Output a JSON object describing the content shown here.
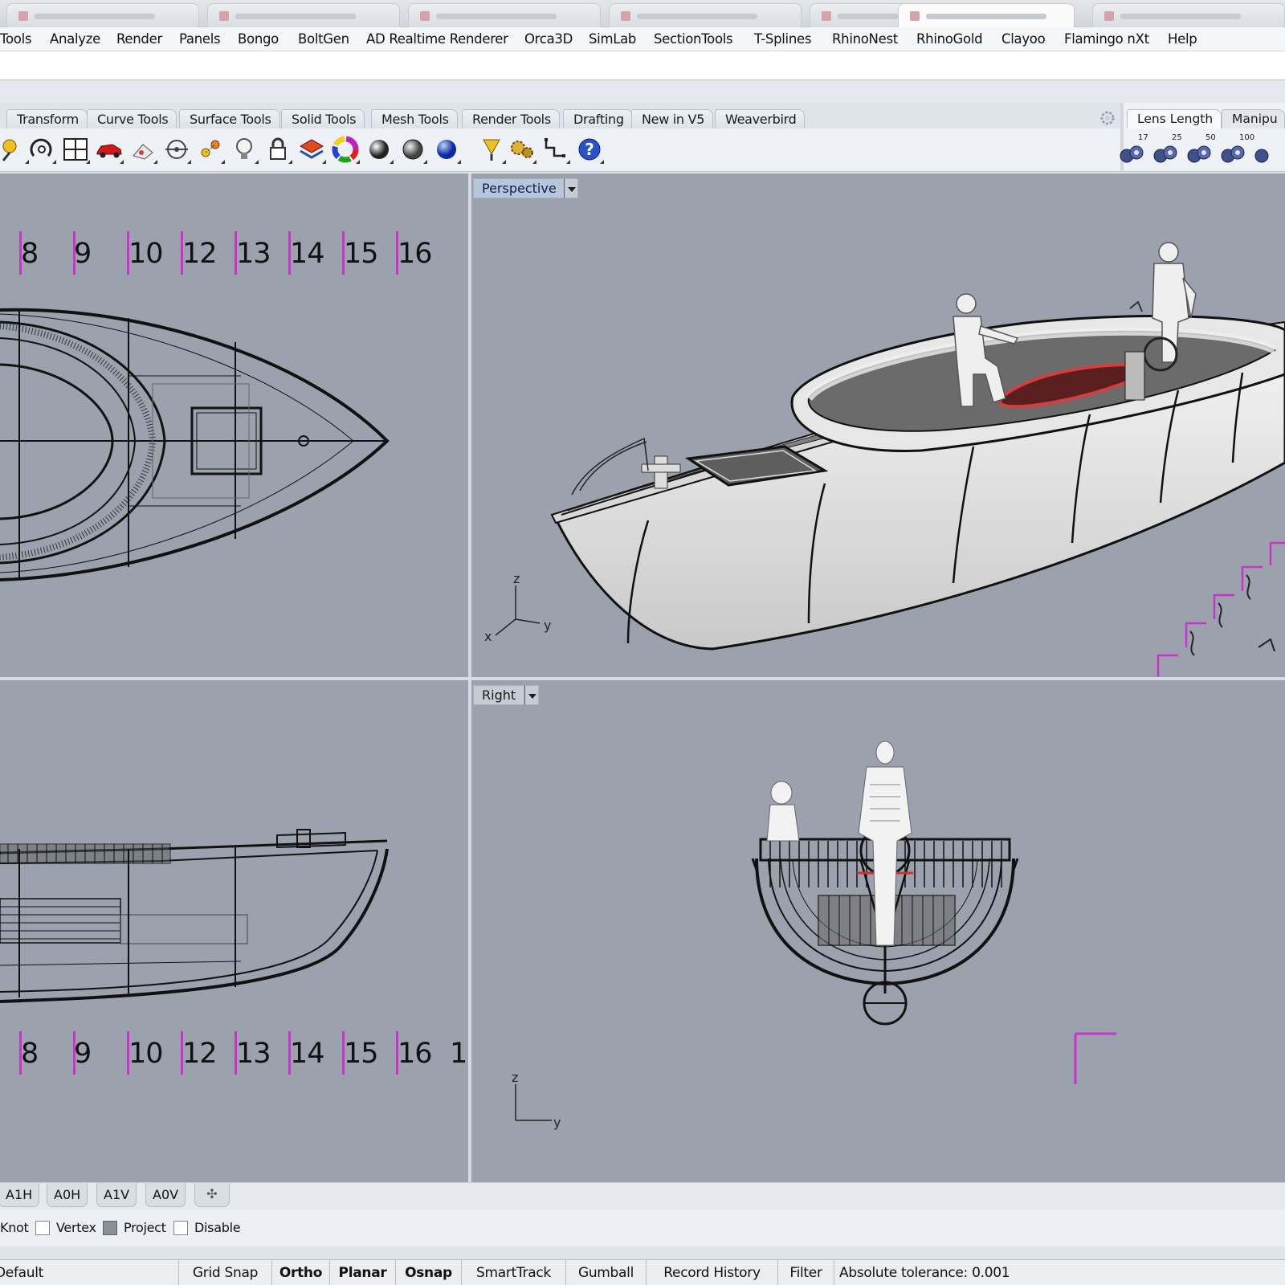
{
  "menu": {
    "items": [
      "Tools",
      "Analyze",
      "Render",
      "Panels",
      "Bongo",
      "BoltGen",
      "AD Realtime Renderer",
      "Orca3D",
      "SimLab",
      "SectionTools",
      "T-Splines",
      "RhinoNest",
      "RhinoGold",
      "Clayoo",
      "Flamingo nXt",
      "Help"
    ]
  },
  "command": {
    "value": ""
  },
  "toolbar": {
    "tabs": [
      "Transform",
      "Curve Tools",
      "Surface Tools",
      "Solid Tools",
      "Mesh Tools",
      "Render Tools",
      "Drafting",
      "New in V5",
      "Weaverbird"
    ],
    "icons": [
      "pen-icon",
      "rotate-view-icon",
      "four-viewports-icon",
      "car-icon",
      "dimension-icon",
      "target-icon",
      "snap-icon",
      "light-bulb-icon",
      "lock-icon",
      "layer-icon",
      "color-wheel-icon",
      "sphere-icon",
      "shaded-sphere-icon",
      "render-sphere-icon",
      "select-filter-icon",
      "gears-icon",
      "steps-icon",
      "help-icon"
    ]
  },
  "right_panel": {
    "tabs": [
      "Lens Length",
      "Manipu"
    ],
    "lens_values": [
      "17",
      "25",
      "50",
      "100"
    ]
  },
  "viewports": {
    "top": {
      "ruler": [
        "8",
        "9",
        "10",
        "12",
        "13",
        "14",
        "15",
        "16"
      ]
    },
    "perspective": {
      "label": "Perspective",
      "axes": {
        "z": "z",
        "x": "x",
        "y": "y"
      }
    },
    "front": {
      "ruler": [
        "8",
        "9",
        "10",
        "12",
        "13",
        "14",
        "15",
        "16",
        "1"
      ]
    },
    "right": {
      "label": "Right",
      "axes": {
        "z": "z",
        "y": "y"
      }
    }
  },
  "layout_tabs": [
    "A1H",
    "A0H",
    "A1V",
    "A0V"
  ],
  "osnap": {
    "items": [
      {
        "label": "Knot",
        "checked": null
      },
      {
        "label": "Vertex",
        "checked": false
      },
      {
        "label": "Project",
        "checked": true
      },
      {
        "label": "Disable",
        "checked": false
      }
    ]
  },
  "status": {
    "layer": "Default",
    "toggles": [
      {
        "label": "Grid Snap",
        "active": false
      },
      {
        "label": "Ortho",
        "active": true
      },
      {
        "label": "Planar",
        "active": true
      },
      {
        "label": "Osnap",
        "active": true
      },
      {
        "label": "SmartTrack",
        "active": false
      },
      {
        "label": "Gumball",
        "active": false
      },
      {
        "label": "Record History",
        "active": false
      },
      {
        "label": "Filter",
        "active": false
      }
    ],
    "tolerance": "Absolute tolerance: 0.001"
  },
  "colors": {
    "viewport_bg": "#9ba2ad",
    "ruler_tick": "#cc33cc",
    "selection": "#c0393b"
  }
}
